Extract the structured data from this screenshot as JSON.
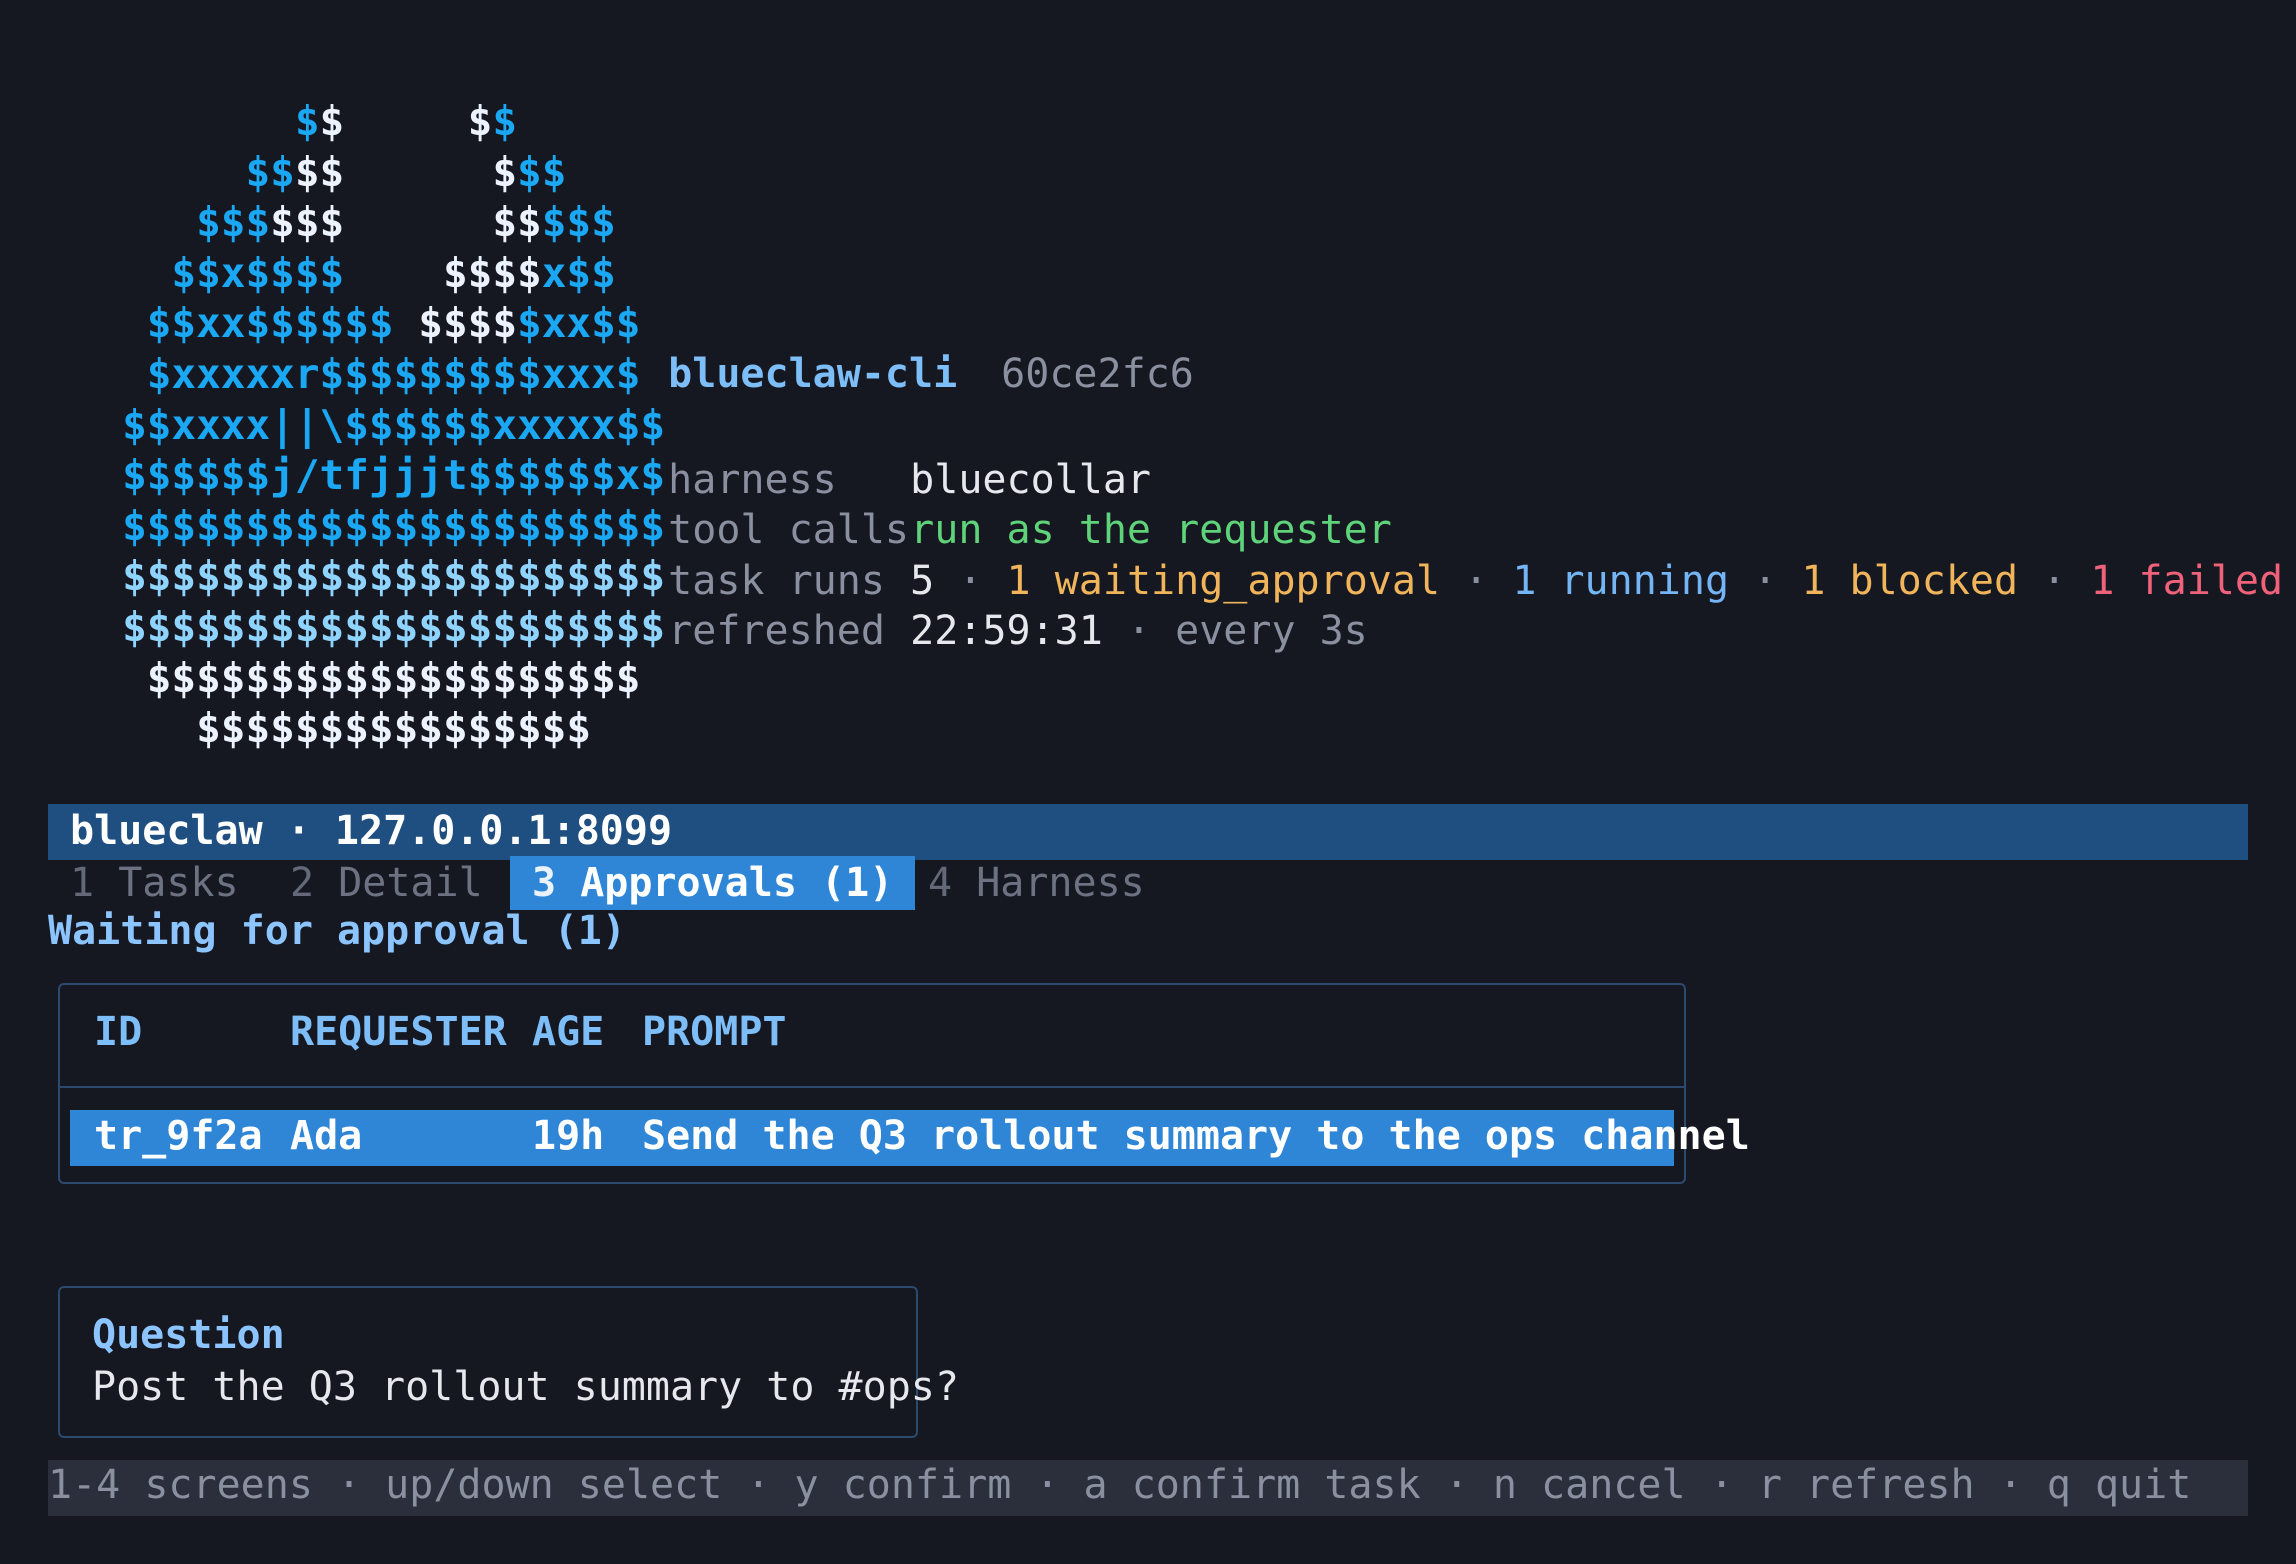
{
  "logo": {
    "rows": [
      [
        [
          "",
          ""
        ],
        [
          "          ",
          ""
        ],
        [
          "$",
          "b"
        ],
        [
          "$",
          "w"
        ],
        [
          "     ",
          ""
        ],
        [
          "$",
          "w"
        ],
        [
          "$",
          "b"
        ]
      ],
      [
        [
          "        ",
          ""
        ],
        [
          "$$",
          "b"
        ],
        [
          "$$",
          "w"
        ],
        [
          "      ",
          ""
        ],
        [
          "$",
          "w"
        ],
        [
          "$$",
          "b"
        ]
      ],
      [
        [
          "      ",
          ""
        ],
        [
          "$$$",
          "b"
        ],
        [
          "$$$",
          "w"
        ],
        [
          "      ",
          ""
        ],
        [
          "$$",
          "w"
        ],
        [
          "$$$",
          "b"
        ]
      ],
      [
        [
          "     ",
          ""
        ],
        [
          "$$x$$$$",
          "b"
        ],
        [
          "    ",
          ""
        ],
        [
          "$$$$",
          "w"
        ],
        [
          "x$$",
          "b"
        ]
      ],
      [
        [
          "    ",
          ""
        ],
        [
          "$$xx$$$$$$",
          "b"
        ],
        [
          " ",
          ""
        ],
        [
          "$$$$",
          "w"
        ],
        [
          "$xx$$",
          "b"
        ]
      ],
      [
        [
          "    ",
          ""
        ],
        [
          "$xxxxxr$$$$$$$$$xxx$",
          "b"
        ]
      ],
      [
        [
          "   ",
          ""
        ],
        [
          "$$xxxx||\\$$$$$$xxxxx$$",
          "b"
        ]
      ],
      [
        [
          "   ",
          ""
        ],
        [
          "$$$$$$j/tfjjjt$$$$$$x$",
          "b"
        ]
      ],
      [
        [
          "   ",
          ""
        ],
        [
          "$$$$$$$$$$$$$$$$$$$$$$",
          "b"
        ]
      ],
      [
        [
          "   ",
          ""
        ],
        [
          "$$$$$$$$$$$$$$$$$$$$$$",
          "l"
        ]
      ],
      [
        [
          "   ",
          ""
        ],
        [
          "$$$$$$$$$$$$$$$$$$$$$$",
          "l"
        ]
      ],
      [
        [
          "    ",
          ""
        ],
        [
          "$$$$$$$$$$$$$$$$$$$$",
          "w"
        ]
      ],
      [
        [
          "      ",
          ""
        ],
        [
          "$$$$$$$$$$$$$$$$",
          "w"
        ]
      ]
    ]
  },
  "header": {
    "app_name": "blueclaw-cli",
    "commit": "60ce2fc6",
    "harness_key": "harness",
    "harness_val": "bluecollar",
    "tool_calls_key": "tool calls",
    "tool_calls_val": "run as the requester",
    "task_runs_key": "task runs",
    "task_runs_total": "5",
    "task_runs_waiting": "1 waiting_approval",
    "task_runs_running": "1 running",
    "task_runs_blocked": "1 blocked",
    "task_runs_failed": "1 failed",
    "refreshed_key": "refreshed",
    "refreshed_time": "22:59:31",
    "refreshed_interval": "every 3s",
    "sep": "·"
  },
  "titlebar": {
    "text": "blueclaw · 127.0.0.1:8099"
  },
  "tabs": [
    {
      "num": "1",
      "label": "Tasks"
    },
    {
      "num": "2",
      "label": "Detail"
    },
    {
      "num": "3",
      "label": "Approvals (1)"
    },
    {
      "num": "4",
      "label": "Harness"
    }
  ],
  "section_title": "Waiting for approval (1)",
  "table": {
    "headers": [
      "ID",
      "REQUESTER",
      "AGE",
      "PROMPT"
    ],
    "rows": [
      {
        "id": "tr_9f2a",
        "requester": "Ada",
        "age": "19h",
        "prompt": "Send the Q3 rollout summary to the ops channel"
      }
    ]
  },
  "question": {
    "title": "Question",
    "text": "Post the Q3 rollout summary to #ops?"
  },
  "footer": {
    "text": "1-4 screens · up/down select · y confirm · a confirm task · n cancel · r refresh · q quit"
  },
  "colors": {
    "background": "#161821",
    "accent": "#2f86d6",
    "titlebar": "#1f4f80",
    "green": "#5fd37a",
    "orange": "#f0b45a",
    "blue": "#74b6f5",
    "red": "#f0617a"
  }
}
